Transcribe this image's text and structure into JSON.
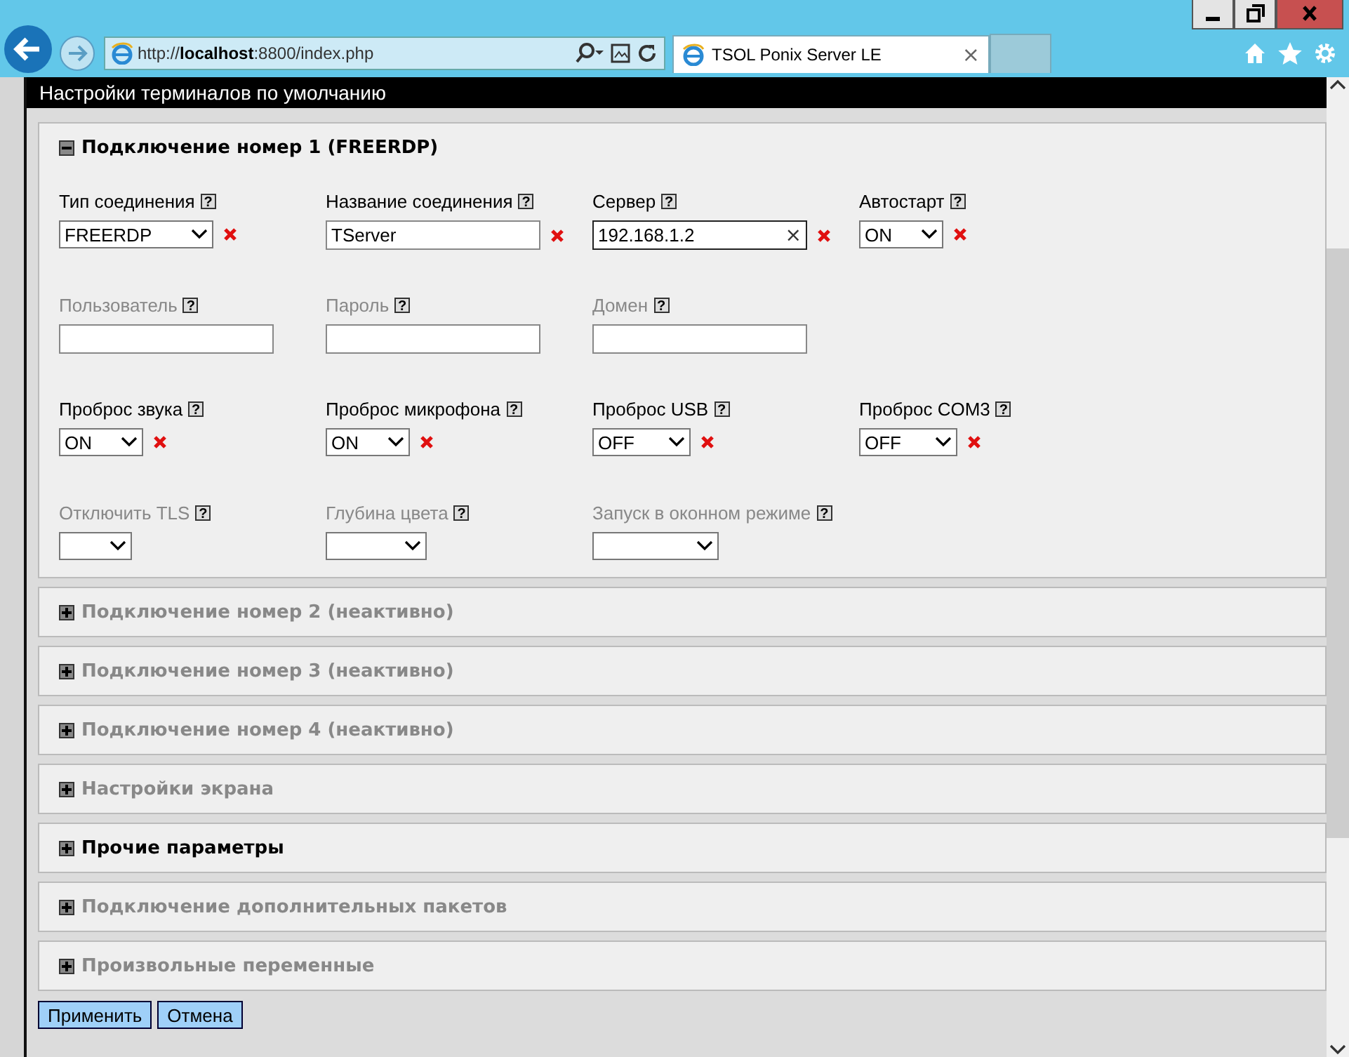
{
  "browser": {
    "address": "http://**localhost**:8800/index.php",
    "tab": {
      "title": "TSOL Ponix Server LE",
      "close": "×"
    }
  },
  "page_title": "Настройки терминалов по умолчанию",
  "sections": [
    {
      "title": "Подключение номер 1 (FREERDP)",
      "expanded": true,
      "active": true,
      "fields": [
        {
          "label": "Тип соединения",
          "help": "?",
          "kind": "select",
          "value": "FREERDP",
          "dimmed": false,
          "required": true
        },
        {
          "label": "Название соединения",
          "help": "?",
          "kind": "text",
          "value": "TServer",
          "dimmed": false,
          "required": true
        },
        {
          "label": "Сервер",
          "help": "?",
          "kind": "text",
          "value": "192.168.1.2",
          "clear": "×",
          "dimmed": false,
          "required": true
        },
        {
          "label": "Автостарт",
          "help": "?",
          "kind": "select",
          "value": "ON",
          "dimmed": false,
          "required": true
        },
        {
          "label": "Пользователь",
          "help": "?",
          "kind": "text",
          "dimmed": true
        },
        {
          "label": "Пароль",
          "help": "?",
          "kind": "text",
          "dimmed": true
        },
        {
          "label": "Домен",
          "help": "?",
          "kind": "text",
          "dimmed": true
        },
        {
          "kind": "blank"
        },
        {
          "label": "Проброс звука",
          "help": "?",
          "kind": "select",
          "value": "ON",
          "dimmed": false,
          "required": true
        },
        {
          "label": "Проброс микрофона",
          "help": "?",
          "kind": "select",
          "value": "ON",
          "dimmed": false,
          "required": true
        },
        {
          "label": "Проброс USB",
          "help": "?",
          "kind": "select",
          "value": "OFF",
          "dimmed": false,
          "required": true
        },
        {
          "label": "Проброс COM3",
          "help": "?",
          "kind": "select",
          "value": "OFF",
          "dimmed": false,
          "required": true
        },
        {
          "label": "Отключить TLS",
          "help": "?",
          "kind": "select",
          "dimmed": true
        },
        {
          "label": "Глубина цвета",
          "help": "?",
          "kind": "select",
          "dimmed": true
        },
        {
          "label": "Запуск в оконном режиме",
          "help": "?",
          "kind": "select",
          "dimmed": true
        }
      ]
    },
    {
      "title": "Подключение номер 2 (неактивно)",
      "expanded": false,
      "active": false
    },
    {
      "title": "Подключение номер 3 (неактивно)",
      "expanded": false,
      "active": false
    },
    {
      "title": "Подключение номер 4 (неактивно)",
      "expanded": false,
      "active": false
    },
    {
      "title": "Настройки экрана",
      "expanded": false,
      "active": false
    },
    {
      "title": "Прочие параметры",
      "expanded": false,
      "active": true
    },
    {
      "title": "Подключение дополнительных пакетов",
      "expanded": false,
      "active": false
    },
    {
      "title": "Произвольные переменные",
      "expanded": false,
      "active": false
    }
  ],
  "buttons": [
    "Применить",
    "Отмена"
  ]
}
